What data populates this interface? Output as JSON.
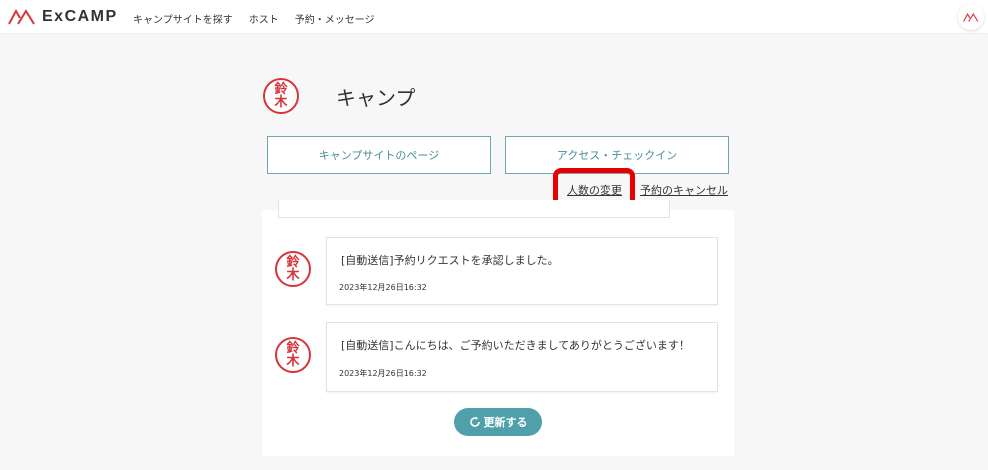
{
  "header": {
    "brand": "ExCAMP",
    "nav": [
      "キャンプサイトを探す",
      "ホスト",
      "予約・メッセージ"
    ]
  },
  "host": {
    "name": "キャンプ",
    "seal_chars": [
      "鈴",
      "木"
    ]
  },
  "actions": {
    "campsite_page": "キャンプサイトのページ",
    "access_checkin": "アクセス・チェックイン",
    "change_people": "人数の変更",
    "cancel_reservation": "予約のキャンセル"
  },
  "messages": [
    {
      "text": "[自動送信]予約リクエストを承認しました。",
      "time": "2023年12月26日16:32"
    },
    {
      "text": "[自動送信]こんにちは、ご予約いただきましてありがとうございます！",
      "time": "2023年12月26日16:32"
    }
  ],
  "refresh_label": "更新する",
  "colors": {
    "accent": "#4fa0ab",
    "seal": "#d8343a",
    "highlight": "#e60000"
  },
  "icons": {
    "logo": "mountain-logo-icon",
    "refresh": "refresh-icon"
  }
}
